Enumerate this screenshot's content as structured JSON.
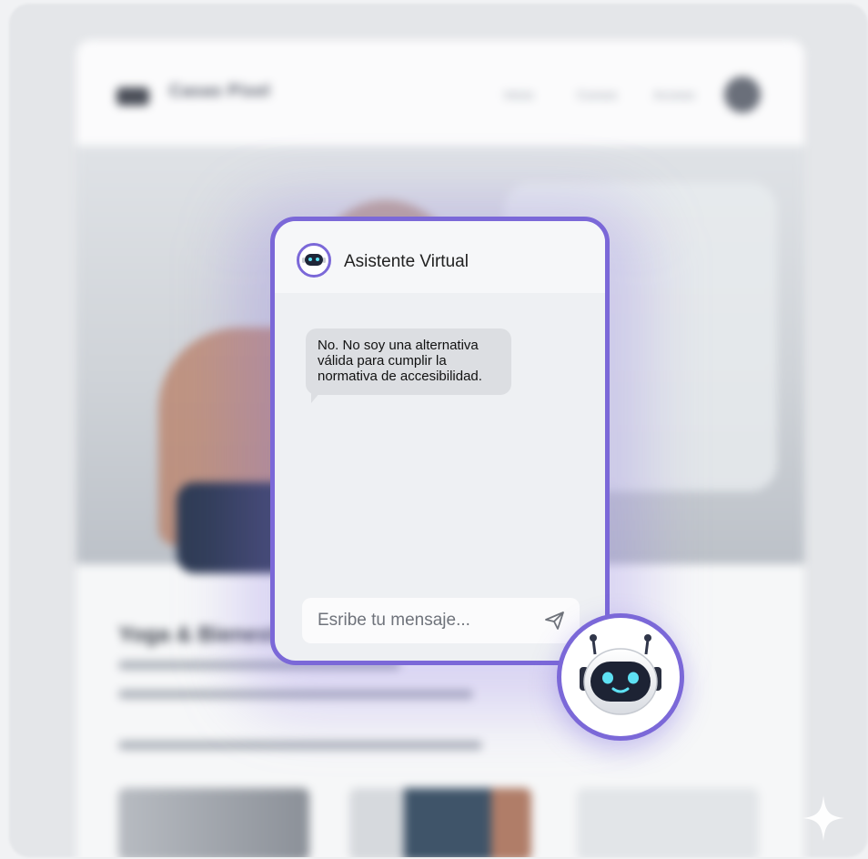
{
  "background_site": {
    "logo_text": "Casas Pixel",
    "nav": [
      "Inicio",
      "Cursos",
      "Acceso"
    ],
    "content_title": "Yoga & Bienestar"
  },
  "chat": {
    "title": "Asistente Virtual",
    "message": "No. No soy una alternativa válida para cumplir la normativa de accesibilidad.",
    "input_placeholder": "Esribe tu mensaje..."
  },
  "colors": {
    "accent": "#7b68d8",
    "bubble": "#dcdee2",
    "panel": "#eef0f3",
    "robot_eyes": "#5ee1f3"
  },
  "icons": {
    "header_avatar": "robot-icon",
    "send": "paper-plane-icon",
    "launcher": "robot-icon",
    "corner": "sparkle-icon"
  }
}
